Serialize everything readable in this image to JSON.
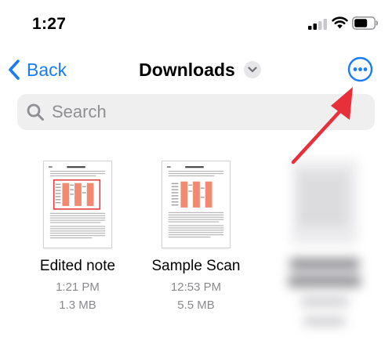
{
  "status_bar": {
    "time": "1:27"
  },
  "nav": {
    "back_label": "Back",
    "title": "Downloads"
  },
  "search": {
    "placeholder": "Search"
  },
  "files": [
    {
      "name": "Edited note",
      "time": "1:21 PM",
      "size": "1.3 MB"
    },
    {
      "name": "Sample Scan",
      "time": "12:53 PM",
      "size": "5.5 MB"
    }
  ],
  "colors": {
    "accent": "#1a7cf5",
    "annotation": "#e8303a",
    "search_bg": "#efeff0",
    "meta_text": "#8a8a8e"
  },
  "icons": {
    "back": "chevron-left-icon",
    "title_menu": "chevron-down-icon",
    "more": "ellipsis-circle-icon",
    "search": "magnifier-icon",
    "signal": "cellular-signal-icon",
    "wifi": "wifi-icon",
    "battery": "battery-icon"
  }
}
